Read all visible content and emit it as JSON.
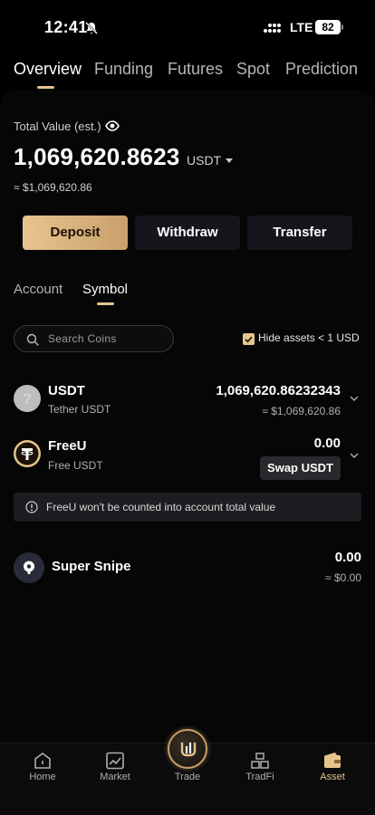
{
  "status_bar": {
    "time": "12:41",
    "network": "LTE",
    "battery": "82"
  },
  "top_tabs": [
    "Overview",
    "Funding",
    "Futures",
    "Spot",
    "Prediction"
  ],
  "total": {
    "label": "Total Value (est.)",
    "value": "1,069,620.8623",
    "unit": "USDT",
    "approx": "≈ $1,069,620.86"
  },
  "actions": {
    "deposit": "Deposit",
    "withdraw": "Withdraw",
    "transfer": "Transfer"
  },
  "sub_tabs": {
    "account": "Account",
    "symbol": "Symbol"
  },
  "search": {
    "placeholder": "Search Coins"
  },
  "hide_small": {
    "label": "Hide assets < 1 USD",
    "checked": true
  },
  "assets": [
    {
      "symbol": "USDT",
      "name": "Tether USDT",
      "amount": "1,069,620.86232343",
      "value": "≈ $1,069,620.86"
    },
    {
      "symbol": "FreeU",
      "name": "Free USDT",
      "amount": "0.00",
      "button": "Swap USDT"
    }
  ],
  "notice": "FreeU won't be counted into account total value",
  "super_snipe": {
    "name": "Super Snipe",
    "amount": "0.00",
    "value": "≈ $0.00"
  },
  "bottom_nav": [
    {
      "label": "Home",
      "icon": "home-icon"
    },
    {
      "label": "Market",
      "icon": "chart-icon"
    },
    {
      "label": "Trade",
      "icon": "trade-logo-icon"
    },
    {
      "label": "TradFi",
      "icon": "bank-icon"
    },
    {
      "label": "Asset",
      "icon": "wallet-icon"
    }
  ],
  "colors": {
    "accent": "#e5c58c",
    "background": "#000000",
    "surface": "#15151b"
  }
}
